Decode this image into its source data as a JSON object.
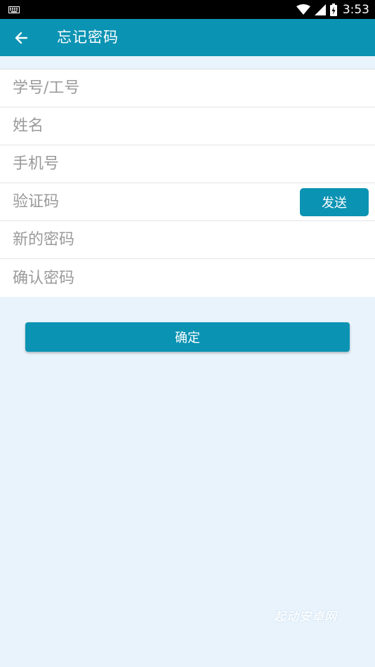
{
  "status_bar": {
    "time": "3:53",
    "icons": [
      "keyboard-icon",
      "wifi-icon",
      "cell-signal-icon",
      "battery-charging-icon"
    ]
  },
  "app_bar": {
    "title": "忘记密码",
    "back_icon": "arrow-left-icon",
    "color": "#0b93b3"
  },
  "form": {
    "fields": [
      {
        "name": "student-id",
        "placeholder": "学号/工号",
        "value": ""
      },
      {
        "name": "name",
        "placeholder": "姓名",
        "value": ""
      },
      {
        "name": "phone",
        "placeholder": "手机号",
        "value": ""
      },
      {
        "name": "code",
        "placeholder": "验证码",
        "value": ""
      },
      {
        "name": "new-password",
        "placeholder": "新的密码",
        "value": ""
      },
      {
        "name": "confirm-password",
        "placeholder": "确认密码",
        "value": ""
      }
    ],
    "send_label": "发送"
  },
  "confirm_label": "确定",
  "watermark": "起动安卓网",
  "colors": {
    "accent": "#0b93b3",
    "background": "#e8f3fc",
    "placeholder": "#9a9a9a"
  }
}
